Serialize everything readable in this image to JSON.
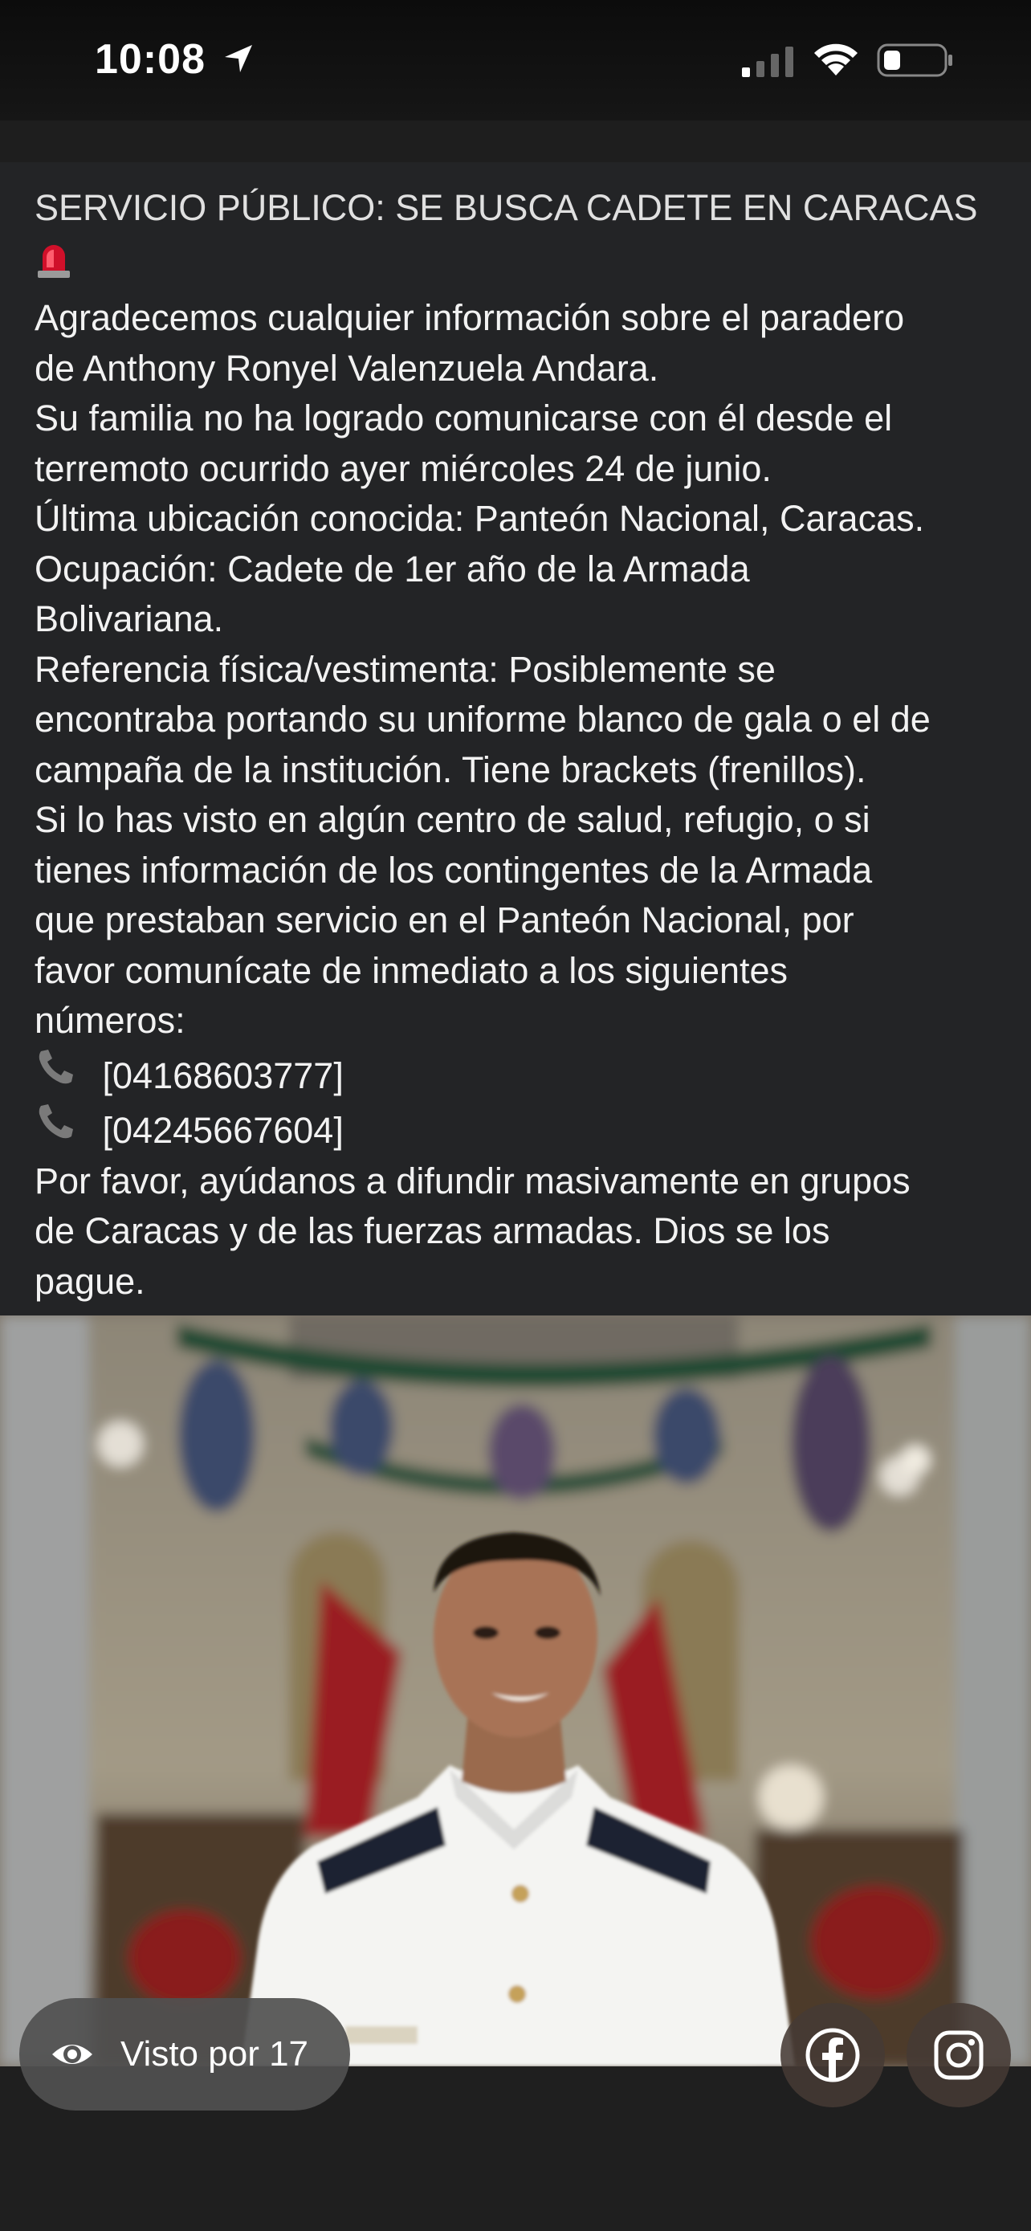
{
  "status_bar": {
    "time": "10:08"
  },
  "story": {
    "title": "SERVICIO PÚBLICO: SE BUSCA CADETE EN CARACAS",
    "lines": [
      "Agradecemos cualquier información sobre el paradero",
      "de Anthony Ronyel Valenzuela Andara.",
      "Su familia no ha logrado comunicarse con él desde el",
      "terremoto ocurrido ayer miércoles 24 de junio.",
      "Última ubicación conocida: Panteón Nacional, Caracas.",
      "Ocupación: Cadete de 1er año de la Armada",
      "Bolivariana.",
      "Referencia física/vestimenta: Posiblemente se",
      "encontraba portando su uniforme blanco de gala o el de",
      "campaña de la institución. Tiene brackets (frenillos).",
      "Si lo has visto en algún centro de salud, refugio, o si",
      "tienes información de los contingentes de la Armada",
      "que prestaban servicio en el Panteón Nacional, por",
      "favor comunícate de inmediato a los siguientes",
      "números:"
    ],
    "phones": [
      "[04168603777]",
      "[04245667604]"
    ],
    "closing_lines": [
      "Por favor, ayúdanos a difundir masivamente en grupos",
      "de Caracas y de las fuerzas armadas. Dios se los",
      "pague."
    ]
  },
  "footer": {
    "views_label": "Visto por 17"
  },
  "icons": {
    "siren": "siren-icon",
    "phone": "phone-icon",
    "eye": "eye-icon",
    "facebook": "facebook-icon",
    "instagram": "instagram-icon"
  },
  "colors": {
    "text_panel": "#232426",
    "siren": "#d0102a",
    "uniform": "#f4f4f2"
  }
}
